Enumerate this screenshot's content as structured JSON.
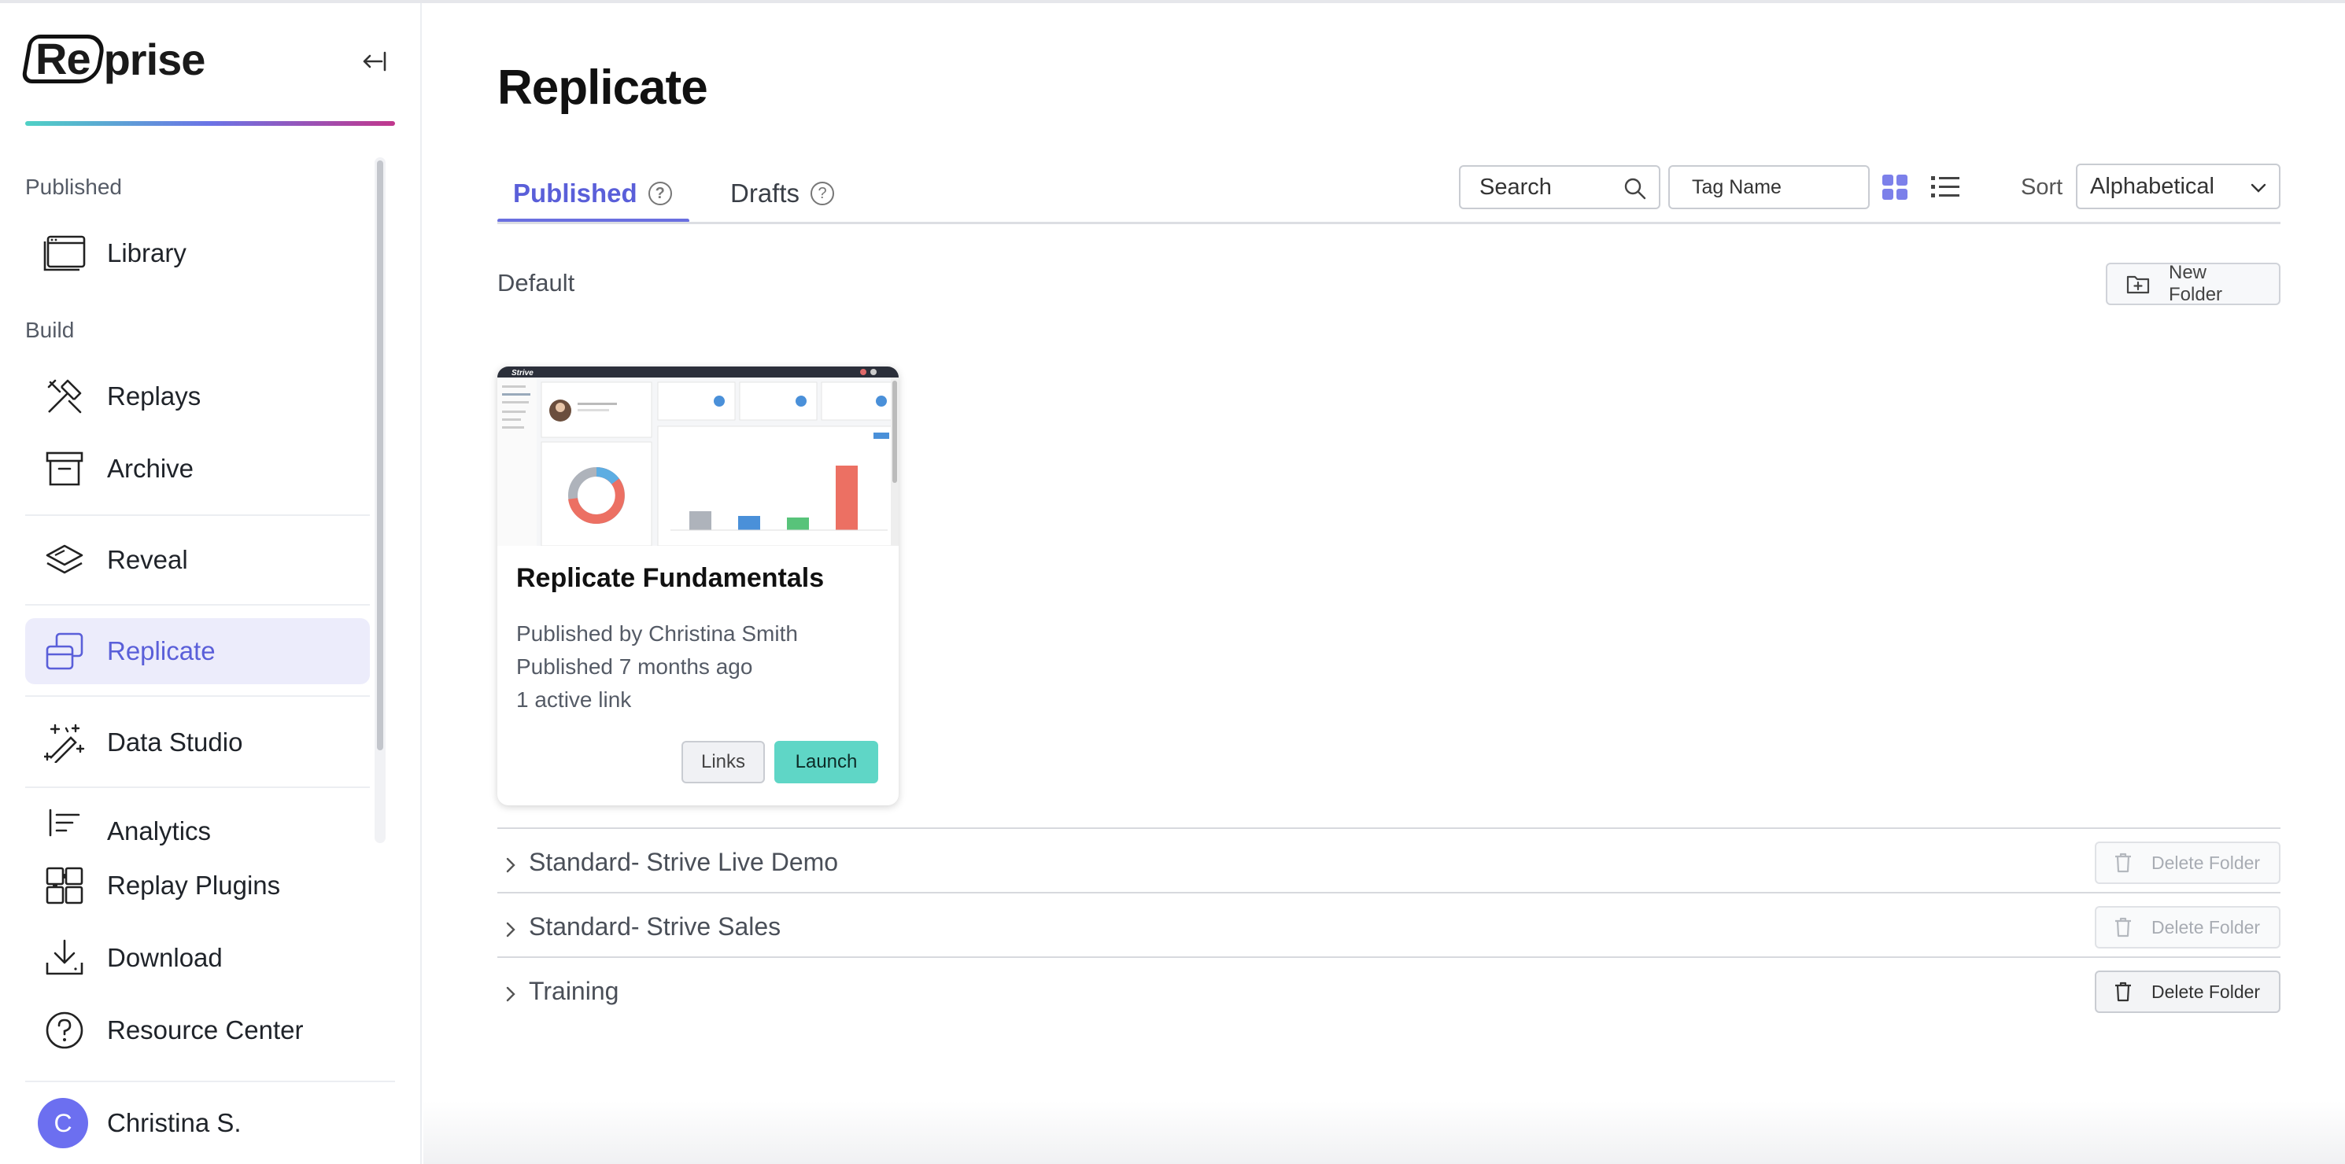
{
  "brand": {
    "logo_boxed": "Re",
    "logo_rest": "prise"
  },
  "sidebar": {
    "sections": {
      "published": "Published",
      "build": "Build"
    },
    "items": [
      {
        "label": "Library",
        "icon": "library-icon"
      },
      {
        "label": "Replays",
        "icon": "tools-icon"
      },
      {
        "label": "Archive",
        "icon": "archive-icon"
      },
      {
        "label": "Reveal",
        "icon": "layers-icon"
      },
      {
        "label": "Replicate",
        "icon": "replicate-icon",
        "active": true
      },
      {
        "label": "Data Studio",
        "icon": "magic-wand-icon"
      },
      {
        "label": "Analytics",
        "icon": "analytics-icon"
      }
    ],
    "bottom": [
      {
        "label": "Replay Plugins",
        "icon": "puzzle-icon"
      },
      {
        "label": "Download",
        "icon": "download-icon"
      },
      {
        "label": "Resource Center",
        "icon": "help-icon"
      }
    ],
    "user": {
      "initial": "C",
      "name": "Christina S."
    }
  },
  "main": {
    "title": "Replicate",
    "tabs": [
      {
        "label": "Published",
        "active": true
      },
      {
        "label": "Drafts",
        "active": false
      }
    ],
    "help_glyph": "?",
    "search": {
      "value": "Search"
    },
    "tag_filter": {
      "value": "Tag Name"
    },
    "sort": {
      "label": "Sort",
      "value": "Alphabetical"
    },
    "default_folder": {
      "name": "Default",
      "new_folder_label": "New Folder",
      "cards": [
        {
          "title": "Replicate Fundamentals",
          "published_by": "Published by Christina Smith",
          "published_ago": "Published 7 months ago",
          "active_links": "1 active link",
          "links_label": "Links",
          "launch_label": "Launch",
          "thumbnail_brand": "Strive"
        }
      ]
    },
    "folders": [
      {
        "name": "Standard- Strive Live Demo",
        "delete_label": "Delete Folder",
        "delete_enabled": false
      },
      {
        "name": "Standard- Strive Sales",
        "delete_label": "Delete Folder",
        "delete_enabled": false
      },
      {
        "name": "Training",
        "delete_label": "Delete Folder",
        "delete_enabled": true
      }
    ]
  },
  "colors": {
    "accent": "#5a5fd9",
    "launch": "#5fd6c6",
    "active_nav_bg": "#ececfb",
    "avatar": "#6c6ff0"
  }
}
